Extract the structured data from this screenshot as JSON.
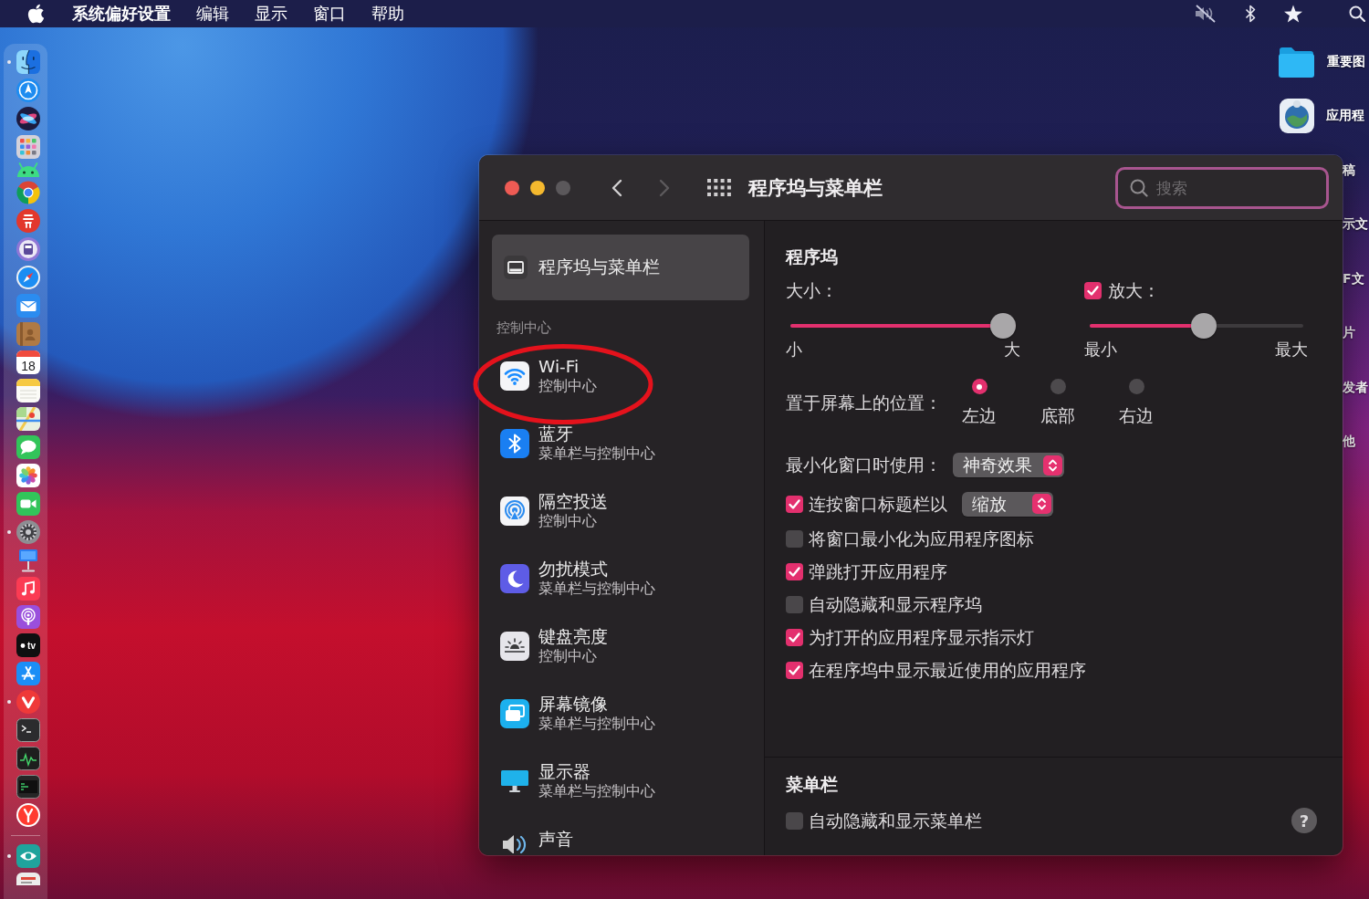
{
  "menu_bar": {
    "app_name": "系统偏好设置",
    "menus": [
      "编辑",
      "显示",
      "窗口",
      "帮助"
    ],
    "status_icons": [
      {
        "kind": "muted-speaker"
      },
      {
        "kind": "bluetooth"
      },
      {
        "kind": "star"
      },
      {
        "kind": "search"
      }
    ]
  },
  "dock": {
    "apps": [
      {
        "kind": "finder",
        "running": true
      },
      {
        "kind": "compass",
        "running": false
      },
      {
        "kind": "siri",
        "running": false
      },
      {
        "kind": "launchpad",
        "running": false
      },
      {
        "kind": "android",
        "running": false
      },
      {
        "kind": "chrome",
        "running": false
      },
      {
        "kind": "red-app",
        "running": false
      },
      {
        "kind": "purple-app",
        "running": false
      },
      {
        "kind": "safari",
        "running": false
      },
      {
        "kind": "mail",
        "running": false
      },
      {
        "kind": "contacts",
        "running": false
      },
      {
        "kind": "calendar",
        "running": false,
        "label": "18"
      },
      {
        "kind": "notes",
        "running": false
      },
      {
        "kind": "maps",
        "running": false
      },
      {
        "kind": "messages",
        "running": false
      },
      {
        "kind": "photos",
        "running": false
      },
      {
        "kind": "facetime",
        "running": false
      },
      {
        "kind": "settings",
        "running": true
      },
      {
        "kind": "keynote",
        "running": false
      },
      {
        "kind": "music",
        "running": false
      },
      {
        "kind": "podcasts",
        "running": false
      },
      {
        "kind": "tv",
        "running": false,
        "label": "tv"
      },
      {
        "kind": "app-store",
        "running": false
      },
      {
        "kind": "vivaldi",
        "running": true
      },
      {
        "kind": "terminal",
        "running": false
      },
      {
        "kind": "activity-monitor",
        "running": false
      },
      {
        "kind": "console",
        "running": false
      },
      {
        "kind": "yandex",
        "running": false
      }
    ],
    "extras": [
      {
        "kind": "teal-app",
        "running": true
      },
      {
        "kind": "document",
        "running": false
      }
    ]
  },
  "desktop_items": [
    {
      "kind": "folder",
      "label": "重要图"
    },
    {
      "kind": "app",
      "label": "应用程"
    },
    {
      "label": "稿"
    },
    {
      "label": "示文"
    },
    {
      "label": "F文"
    },
    {
      "label": "片"
    },
    {
      "label": "发者"
    },
    {
      "label": "他"
    }
  ],
  "window": {
    "title": "程序坞与菜单栏",
    "traffic_lights": [
      {
        "kind": "close",
        "disabled": false
      },
      {
        "kind": "minimize",
        "disabled": false
      },
      {
        "kind": "zoom",
        "disabled": true
      }
    ],
    "back": {
      "disabled": false
    },
    "forward": {
      "disabled": true
    },
    "search": {
      "placeholder": "搜索",
      "focused": true
    },
    "sidebar": {
      "items": [
        {
          "kind": "dock",
          "title": "程序坞与菜单栏",
          "selected": true
        }
      ],
      "section": {
        "title": "控制中心",
        "items": [
          {
            "kind": "wifi",
            "title": "Wi-Fi",
            "subtitle": "控制中心",
            "selected": false,
            "circled": true
          },
          {
            "kind": "bluetooth",
            "title": "蓝牙",
            "subtitle": "菜单栏与控制中心",
            "selected": false,
            "circled": false
          },
          {
            "kind": "airdrop",
            "title": "隔空投送",
            "subtitle": "控制中心",
            "selected": false,
            "circled": false
          },
          {
            "kind": "moon",
            "title": "勿扰模式",
            "subtitle": "菜单栏与控制中心",
            "selected": false,
            "circled": false
          },
          {
            "kind": "keyboard-brightness",
            "title": "键盘亮度",
            "subtitle": "控制中心",
            "selected": false,
            "circled": false
          },
          {
            "kind": "screen-mirroring",
            "title": "屏幕镜像",
            "subtitle": "菜单栏与控制中心",
            "selected": false,
            "circled": false
          },
          {
            "kind": "display",
            "title": "显示器",
            "subtitle": "菜单栏与控制中心",
            "selected": false,
            "circled": false
          },
          {
            "kind": "sound",
            "title": "声音",
            "selected": false,
            "circled": false
          }
        ]
      }
    },
    "dock_settings": {
      "title": "程序坞",
      "size": {
        "label": "大小：",
        "level": 1,
        "min_label": "小",
        "max_label": "大"
      },
      "magnification": {
        "label": "放大：",
        "checked": true,
        "level": 0.54,
        "min_label": "最小",
        "max_label": "最大"
      },
      "position": {
        "label": "置于屏幕上的位置：",
        "options": [
          {
            "label": "左边",
            "selected": true
          },
          {
            "label": "底部",
            "selected": false
          },
          {
            "label": "右边",
            "selected": false
          }
        ]
      },
      "minimize_effect": {
        "label": "最小化窗口时使用：",
        "value": "神奇效果"
      },
      "options": [
        {
          "kind": "checkbox-popup",
          "label": "连按窗口标题栏以",
          "checked": true,
          "value": "缩放"
        },
        {
          "kind": "checkbox",
          "label": "将窗口最小化为应用程序图标",
          "checked": false
        },
        {
          "kind": "checkbox",
          "label": "弹跳打开应用程序",
          "checked": true
        },
        {
          "kind": "checkbox",
          "label": "自动隐藏和显示程序坞",
          "checked": false
        },
        {
          "kind": "checkbox",
          "label": "为打开的应用程序显示指示灯",
          "checked": true
        },
        {
          "kind": "checkbox",
          "label": "在程序坞中显示最近使用的应用程序",
          "checked": true
        }
      ]
    },
    "menu_bar_settings": {
      "title": "菜单栏",
      "options": [
        {
          "kind": "checkbox",
          "label": "自动隐藏和显示菜单栏",
          "checked": false
        }
      ]
    },
    "help_button": {
      "label": "?"
    }
  }
}
